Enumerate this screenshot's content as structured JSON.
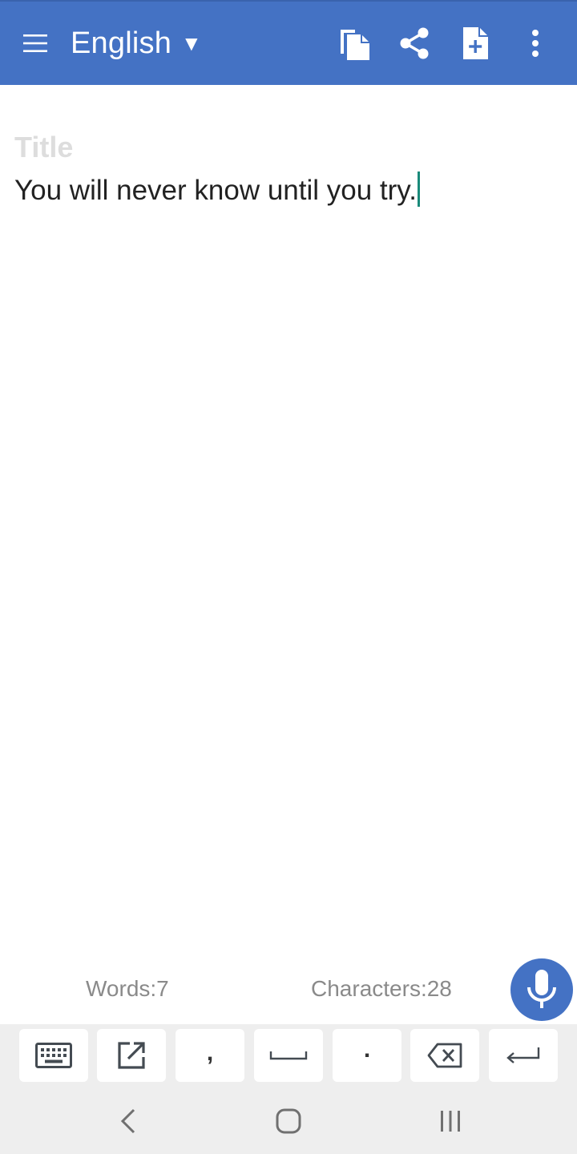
{
  "appbar": {
    "language": "English",
    "caret_glyph": "▼",
    "icons": {
      "menu": "hamburger-menu-icon",
      "copy": "copy-icon",
      "share": "share-icon",
      "new_document": "new-document-icon",
      "more": "more-vert-icon"
    },
    "background_color": "#4472C4"
  },
  "editor": {
    "title_placeholder": "Title",
    "body_text": "You will never know until you try."
  },
  "stats": {
    "words": "Words:7",
    "characters": "Characters:28"
  },
  "fab": {
    "icon": "microphone-icon",
    "color": "#4472C4"
  },
  "keybar": {
    "keys": [
      {
        "icon": "keyboard-icon"
      },
      {
        "icon": "open-external-icon"
      },
      {
        "label": ","
      },
      {
        "icon": "space-icon"
      },
      {
        "label": "."
      },
      {
        "icon": "backspace-icon"
      },
      {
        "icon": "enter-icon"
      }
    ]
  },
  "system_nav": {
    "back": "back-chevron-icon",
    "home": "home-icon",
    "recents": "recent-apps-icon"
  }
}
